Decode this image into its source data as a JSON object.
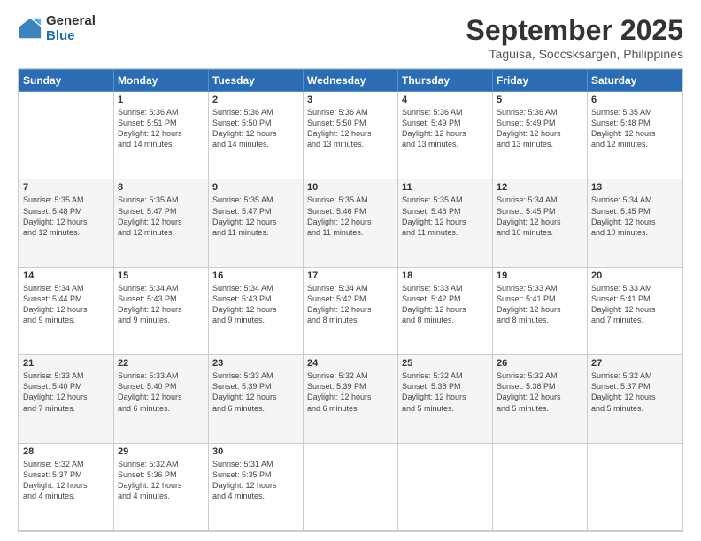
{
  "logo": {
    "general": "General",
    "blue": "Blue"
  },
  "header": {
    "month": "September 2025",
    "location": "Taguisa, Soccsksargen, Philippines"
  },
  "weekdays": [
    "Sunday",
    "Monday",
    "Tuesday",
    "Wednesday",
    "Thursday",
    "Friday",
    "Saturday"
  ],
  "weeks": [
    [
      {
        "day": "",
        "info": ""
      },
      {
        "day": "1",
        "info": "Sunrise: 5:36 AM\nSunset: 5:51 PM\nDaylight: 12 hours\nand 14 minutes."
      },
      {
        "day": "2",
        "info": "Sunrise: 5:36 AM\nSunset: 5:50 PM\nDaylight: 12 hours\nand 14 minutes."
      },
      {
        "day": "3",
        "info": "Sunrise: 5:36 AM\nSunset: 5:50 PM\nDaylight: 12 hours\nand 13 minutes."
      },
      {
        "day": "4",
        "info": "Sunrise: 5:36 AM\nSunset: 5:49 PM\nDaylight: 12 hours\nand 13 minutes."
      },
      {
        "day": "5",
        "info": "Sunrise: 5:36 AM\nSunset: 5:49 PM\nDaylight: 12 hours\nand 13 minutes."
      },
      {
        "day": "6",
        "info": "Sunrise: 5:35 AM\nSunset: 5:48 PM\nDaylight: 12 hours\nand 12 minutes."
      }
    ],
    [
      {
        "day": "7",
        "info": "Sunrise: 5:35 AM\nSunset: 5:48 PM\nDaylight: 12 hours\nand 12 minutes."
      },
      {
        "day": "8",
        "info": "Sunrise: 5:35 AM\nSunset: 5:47 PM\nDaylight: 12 hours\nand 12 minutes."
      },
      {
        "day": "9",
        "info": "Sunrise: 5:35 AM\nSunset: 5:47 PM\nDaylight: 12 hours\nand 11 minutes."
      },
      {
        "day": "10",
        "info": "Sunrise: 5:35 AM\nSunset: 5:46 PM\nDaylight: 12 hours\nand 11 minutes."
      },
      {
        "day": "11",
        "info": "Sunrise: 5:35 AM\nSunset: 5:46 PM\nDaylight: 12 hours\nand 11 minutes."
      },
      {
        "day": "12",
        "info": "Sunrise: 5:34 AM\nSunset: 5:45 PM\nDaylight: 12 hours\nand 10 minutes."
      },
      {
        "day": "13",
        "info": "Sunrise: 5:34 AM\nSunset: 5:45 PM\nDaylight: 12 hours\nand 10 minutes."
      }
    ],
    [
      {
        "day": "14",
        "info": "Sunrise: 5:34 AM\nSunset: 5:44 PM\nDaylight: 12 hours\nand 9 minutes."
      },
      {
        "day": "15",
        "info": "Sunrise: 5:34 AM\nSunset: 5:43 PM\nDaylight: 12 hours\nand 9 minutes."
      },
      {
        "day": "16",
        "info": "Sunrise: 5:34 AM\nSunset: 5:43 PM\nDaylight: 12 hours\nand 9 minutes."
      },
      {
        "day": "17",
        "info": "Sunrise: 5:34 AM\nSunset: 5:42 PM\nDaylight: 12 hours\nand 8 minutes."
      },
      {
        "day": "18",
        "info": "Sunrise: 5:33 AM\nSunset: 5:42 PM\nDaylight: 12 hours\nand 8 minutes."
      },
      {
        "day": "19",
        "info": "Sunrise: 5:33 AM\nSunset: 5:41 PM\nDaylight: 12 hours\nand 8 minutes."
      },
      {
        "day": "20",
        "info": "Sunrise: 5:33 AM\nSunset: 5:41 PM\nDaylight: 12 hours\nand 7 minutes."
      }
    ],
    [
      {
        "day": "21",
        "info": "Sunrise: 5:33 AM\nSunset: 5:40 PM\nDaylight: 12 hours\nand 7 minutes."
      },
      {
        "day": "22",
        "info": "Sunrise: 5:33 AM\nSunset: 5:40 PM\nDaylight: 12 hours\nand 6 minutes."
      },
      {
        "day": "23",
        "info": "Sunrise: 5:33 AM\nSunset: 5:39 PM\nDaylight: 12 hours\nand 6 minutes."
      },
      {
        "day": "24",
        "info": "Sunrise: 5:32 AM\nSunset: 5:39 PM\nDaylight: 12 hours\nand 6 minutes."
      },
      {
        "day": "25",
        "info": "Sunrise: 5:32 AM\nSunset: 5:38 PM\nDaylight: 12 hours\nand 5 minutes."
      },
      {
        "day": "26",
        "info": "Sunrise: 5:32 AM\nSunset: 5:38 PM\nDaylight: 12 hours\nand 5 minutes."
      },
      {
        "day": "27",
        "info": "Sunrise: 5:32 AM\nSunset: 5:37 PM\nDaylight: 12 hours\nand 5 minutes."
      }
    ],
    [
      {
        "day": "28",
        "info": "Sunrise: 5:32 AM\nSunset: 5:37 PM\nDaylight: 12 hours\nand 4 minutes."
      },
      {
        "day": "29",
        "info": "Sunrise: 5:32 AM\nSunset: 5:36 PM\nDaylight: 12 hours\nand 4 minutes."
      },
      {
        "day": "30",
        "info": "Sunrise: 5:31 AM\nSunset: 5:35 PM\nDaylight: 12 hours\nand 4 minutes."
      },
      {
        "day": "",
        "info": ""
      },
      {
        "day": "",
        "info": ""
      },
      {
        "day": "",
        "info": ""
      },
      {
        "day": "",
        "info": ""
      }
    ]
  ]
}
